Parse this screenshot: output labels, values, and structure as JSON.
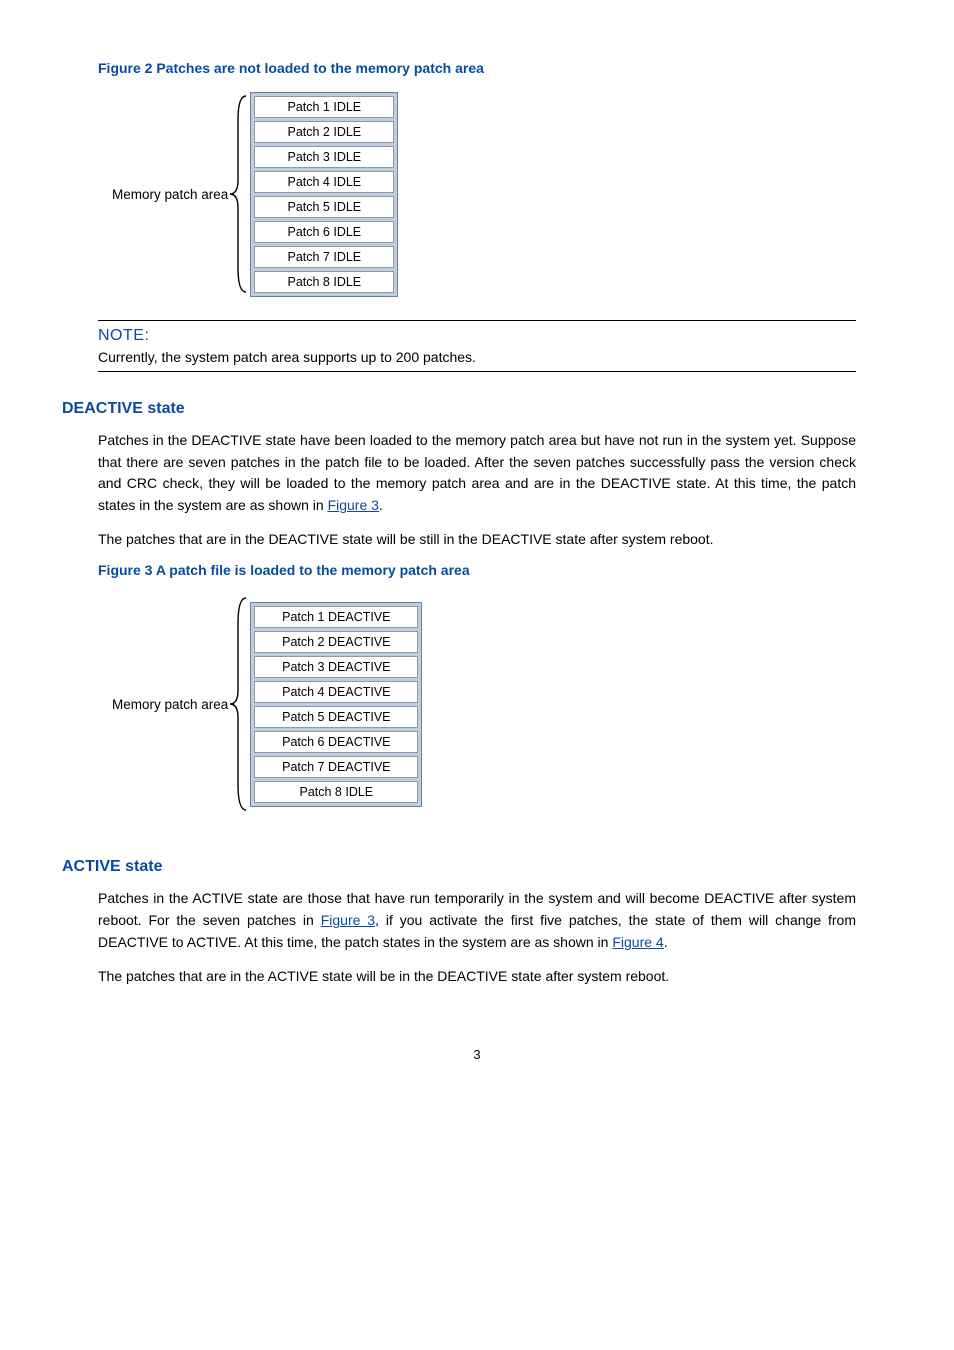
{
  "figure2": {
    "title": "Figure 2 Patches are not loaded to the memory patch area",
    "mem_label": "Memory patch area",
    "rows": [
      "Patch 1 IDLE",
      "Patch 2 IDLE",
      "Patch 3 IDLE",
      "Patch 4 IDLE",
      "Patch 5 IDLE",
      "Patch 6 IDLE",
      "Patch 7 IDLE",
      "Patch 8 IDLE"
    ]
  },
  "note": {
    "label": "NOTE:",
    "text": "Currently, the system patch area supports up to 200 patches."
  },
  "deactive": {
    "heading": "DEACTIVE state",
    "para1_a": "Patches in the DEACTIVE state have been loaded to the memory patch area but have not run in the system yet. Suppose that there are seven patches in the patch file to be loaded. After the seven patches successfully pass the version check and CRC check, they will be loaded to the memory patch area and are in the DEACTIVE state. At this time, the patch states in the system are as shown in ",
    "para1_link": "Figure 3",
    "para1_b": ".",
    "para2": "The patches that are in the DEACTIVE state will be still in the DEACTIVE state after system reboot."
  },
  "figure3": {
    "title": "Figure 3 A patch file is loaded to the memory patch area",
    "mem_label": "Memory patch area",
    "rows": [
      "Patch 1 DEACTIVE",
      "Patch 2 DEACTIVE",
      "Patch 3 DEACTIVE",
      "Patch 4 DEACTIVE",
      "Patch 5 DEACTIVE",
      "Patch 6 DEACTIVE",
      "Patch 7 DEACTIVE",
      "Patch 8 IDLE"
    ]
  },
  "active": {
    "heading": "ACTIVE state",
    "para1_a": "Patches in the ACTIVE state are those that have run temporarily in the system and will become DEACTIVE after system reboot. For the seven patches in ",
    "para1_link1": "Figure 3",
    "para1_b": ", if you activate the first five patches, the state of them will change from DEACTIVE to ACTIVE. At this time, the patch states in the system are as shown in ",
    "para1_link2": "Figure 4",
    "para1_c": ".",
    "para2": "The patches that are in the ACTIVE state will be in the DEACTIVE state after system reboot."
  },
  "pagenum": "3"
}
